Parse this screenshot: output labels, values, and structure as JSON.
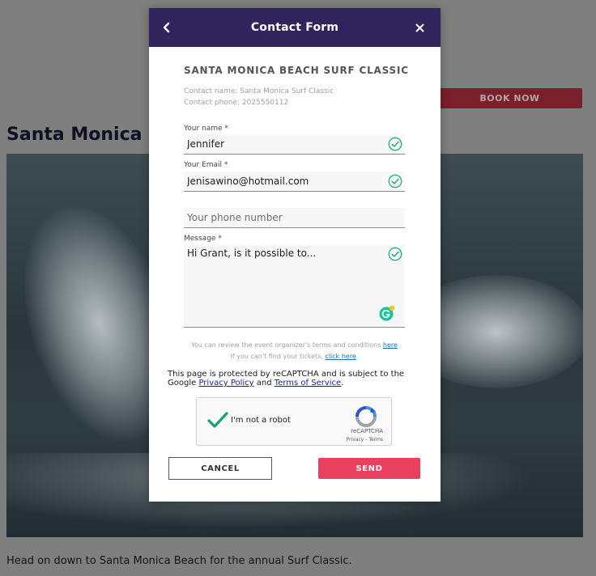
{
  "background": {
    "book_button": "BOOK NOW",
    "event_heading": "Santa Monica Be",
    "description": "Head on down to Santa Monica Beach for the annual Surf Classic."
  },
  "modal": {
    "title": "Contact Form",
    "back_icon": "chevron-left-icon",
    "close_icon": "close-icon",
    "event_name": "SANTA MONICA BEACH SURF CLASSIC",
    "contact_name": "Contact name: Santa Monica Surf Classic",
    "contact_phone": "Contact phone: 2025550112",
    "fields": {
      "name": {
        "label": "Your name *",
        "value": "Jennifer"
      },
      "email": {
        "label": "Your Email *",
        "value": "Jenisawino@hotmail.com"
      },
      "phone": {
        "placeholder": "Your phone number",
        "value": ""
      },
      "message": {
        "label": "Message *",
        "value": "Hi Grant, is it possible to..."
      }
    },
    "terms": {
      "text": "You can review the event organizer's terms and conditions ",
      "link": "here",
      "tickets_text": "If you can't find your tickets, ",
      "tickets_link": "click here",
      "tickets_end": "."
    },
    "recaptcha_note": {
      "prefix": "This page is protected by reCAPTCHA and is subject to the Google ",
      "privacy": "Privacy Policy",
      "and": " and ",
      "terms": "Terms of Service",
      "end": "."
    },
    "captcha": {
      "label": "I'm not a robot",
      "brand": "reCAPTCHA",
      "links": "Privacy - Terms",
      "checked": true
    },
    "buttons": {
      "cancel": "CANCEL",
      "send": "SEND"
    }
  },
  "colors": {
    "header": "#31245c",
    "accent": "#e8415f",
    "valid": "#2db085"
  }
}
